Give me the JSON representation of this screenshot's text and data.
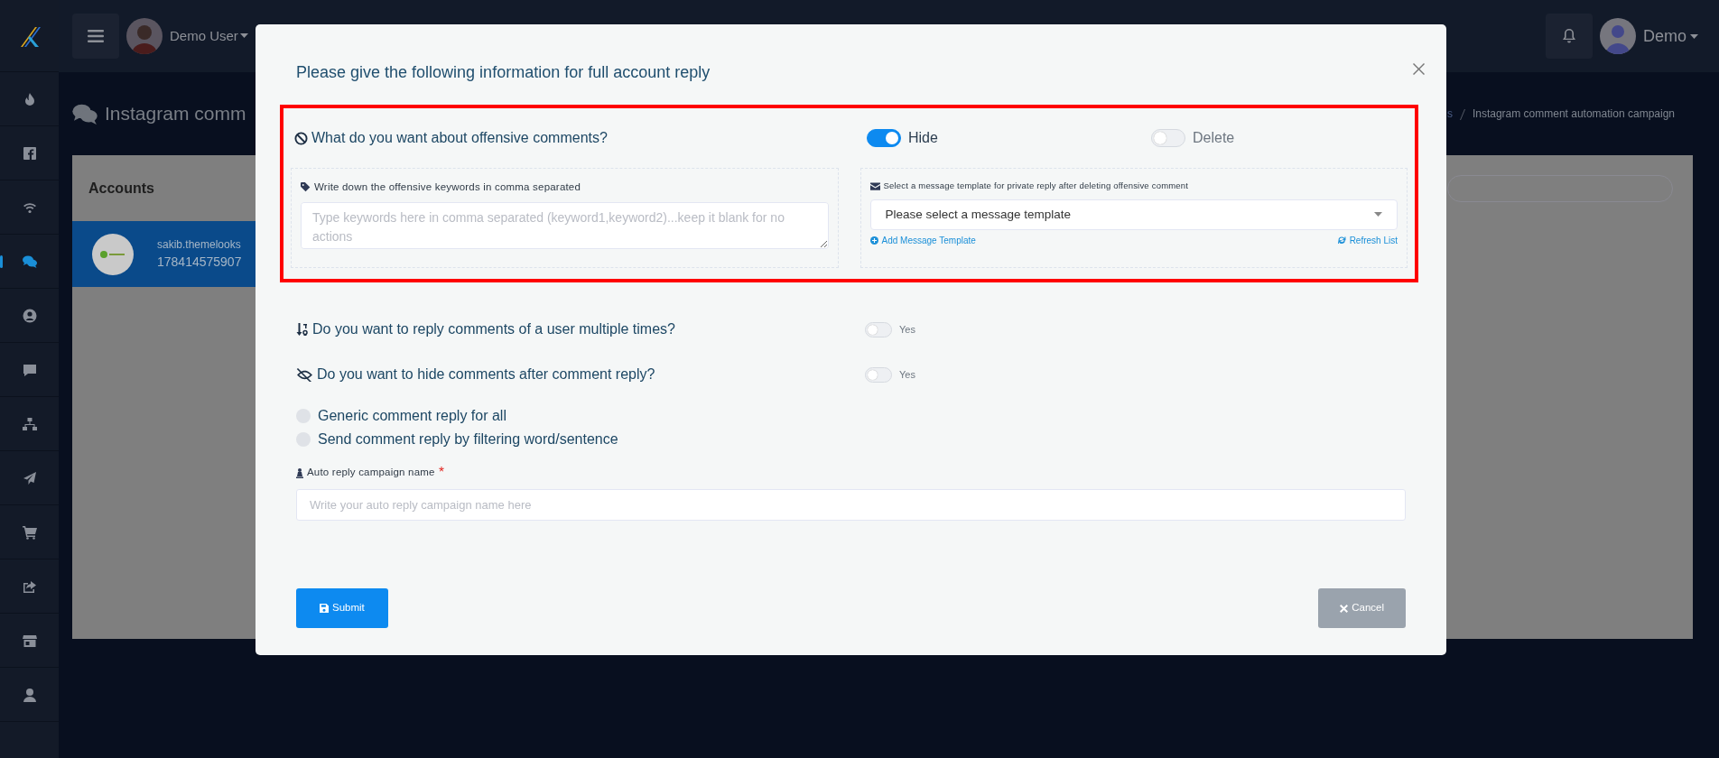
{
  "sidebar": {
    "items": [
      {
        "selected": false
      },
      {
        "selected": false
      },
      {
        "selected": false
      },
      {
        "selected": true
      },
      {
        "selected": false
      },
      {
        "selected": false
      },
      {
        "selected": false
      },
      {
        "selected": false
      },
      {
        "selected": false
      },
      {
        "selected": false
      },
      {
        "selected": false
      },
      {
        "selected": false
      }
    ]
  },
  "topbar": {
    "user_name": "Demo User",
    "account_name": "Demo"
  },
  "page": {
    "title": "Instagram comm",
    "breadcrumb": [
      "s",
      "Instagram comment automation campaign"
    ]
  },
  "accounts": {
    "title": "Accounts",
    "items": [
      {
        "name": "sakib.themelooks",
        "id": "178414575907",
        "selected": true
      }
    ]
  },
  "modal": {
    "title": "Please give the following information for full account reply",
    "offensive": {
      "question": "What do you want about offensive comments?",
      "options": [
        {
          "label": "Hide",
          "on": true
        },
        {
          "label": "Delete",
          "on": false
        }
      ]
    },
    "keywords": {
      "label": "Write down the offensive keywords in comma separated",
      "placeholder": "Type keywords here in comma separated (keyword1,keyword2)...keep it blank for no actions"
    },
    "template": {
      "label": "Select a message template for private reply after deleting offensive comment",
      "value": "Please select a message template",
      "add_link": "Add Message Template",
      "refresh_link": "Refresh List"
    },
    "settings": [
      {
        "kind": "sort",
        "question": "Do you want to reply comments of a user multiple times?",
        "toggle_label": "Yes",
        "on": false
      },
      {
        "kind": "hide",
        "question": "Do you want to hide comments after comment reply?",
        "toggle_label": "Yes",
        "on": false
      }
    ],
    "reply_types": [
      {
        "label": "Generic comment reply for all",
        "selected": false
      },
      {
        "label": "Send comment reply by filtering word/sentence",
        "selected": false
      }
    ],
    "campaign_name": {
      "label": "Auto reply campaign name",
      "required": true,
      "placeholder": "Write your auto reply campaign name here"
    },
    "submit": "Submit",
    "cancel": "Cancel"
  }
}
